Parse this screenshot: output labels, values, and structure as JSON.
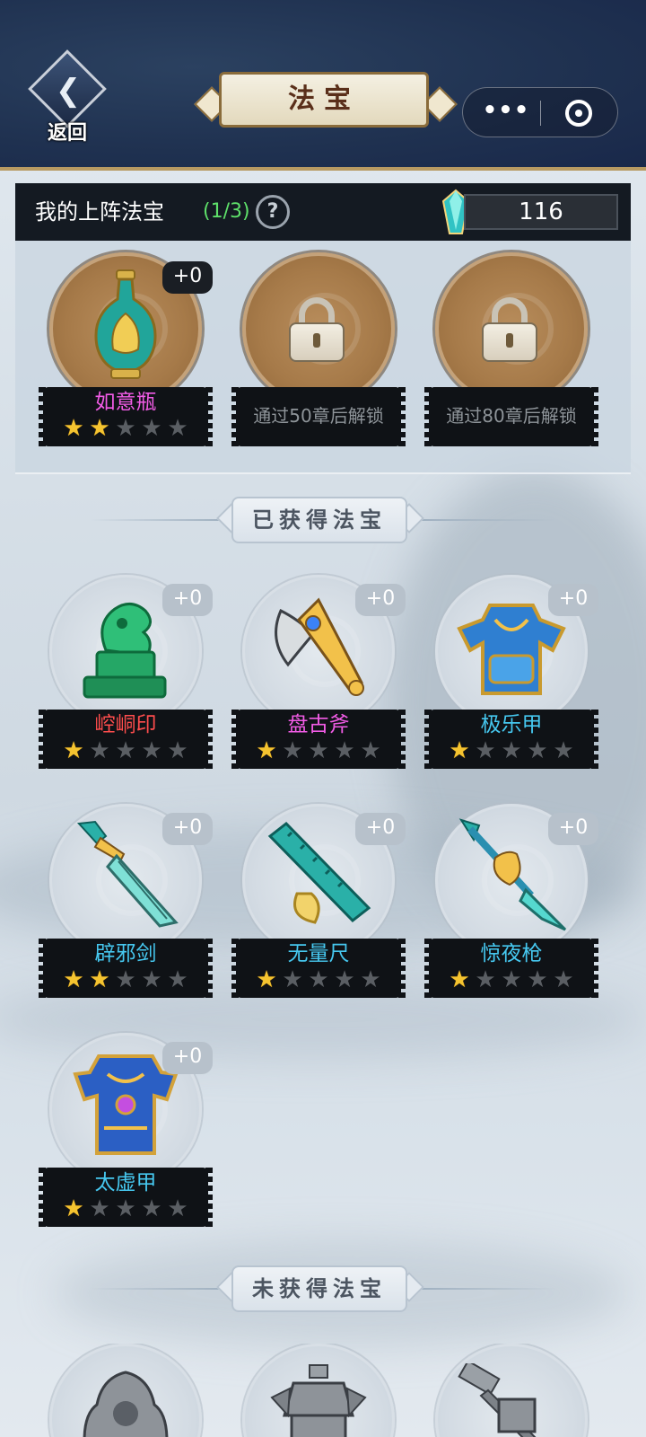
{
  "header": {
    "back_label": "返回",
    "title": "法宝",
    "menu_dots": "•••"
  },
  "equipped": {
    "title": "我的上阵法宝",
    "count": "(1/3)",
    "help": "?",
    "gems": "116",
    "slots": [
      {
        "name": "如意瓶",
        "level": "+0",
        "stars": 2,
        "name_color": "#f25ce6",
        "item_icon": "vase-icon"
      },
      {
        "lock_text": "通过50章后解锁",
        "locked": true
      },
      {
        "lock_text": "通过80章后解锁",
        "locked": true
      }
    ]
  },
  "obtained": {
    "header": "已获得法宝",
    "items": [
      {
        "name": "崆峒印",
        "level": "+0",
        "stars": 1,
        "name_color": "#ff4d4d",
        "item_icon": "jade-seal-icon"
      },
      {
        "name": "盘古斧",
        "level": "+0",
        "stars": 1,
        "name_color": "#f25ce6",
        "item_icon": "axe-icon"
      },
      {
        "name": "极乐甲",
        "level": "+0",
        "stars": 1,
        "name_color": "#46c8f0",
        "item_icon": "armor-icon"
      },
      {
        "name": "辟邪剑",
        "level": "+0",
        "stars": 2,
        "name_color": "#46c8f0",
        "item_icon": "sword-icon"
      },
      {
        "name": "无量尺",
        "level": "+0",
        "stars": 1,
        "name_color": "#46c8f0",
        "item_icon": "ruler-icon"
      },
      {
        "name": "惊夜枪",
        "level": "+0",
        "stars": 1,
        "name_color": "#46c8f0",
        "item_icon": "spear-icon"
      },
      {
        "name": "太虚甲",
        "level": "+0",
        "stars": 1,
        "name_color": "#46c8f0",
        "item_icon": "armor-icon"
      }
    ]
  },
  "not_obtained": {
    "header": "未获得法宝",
    "item_icons": [
      "bell-icon",
      "tripod-icon",
      "hammer-icon"
    ]
  },
  "max_stars": 5
}
